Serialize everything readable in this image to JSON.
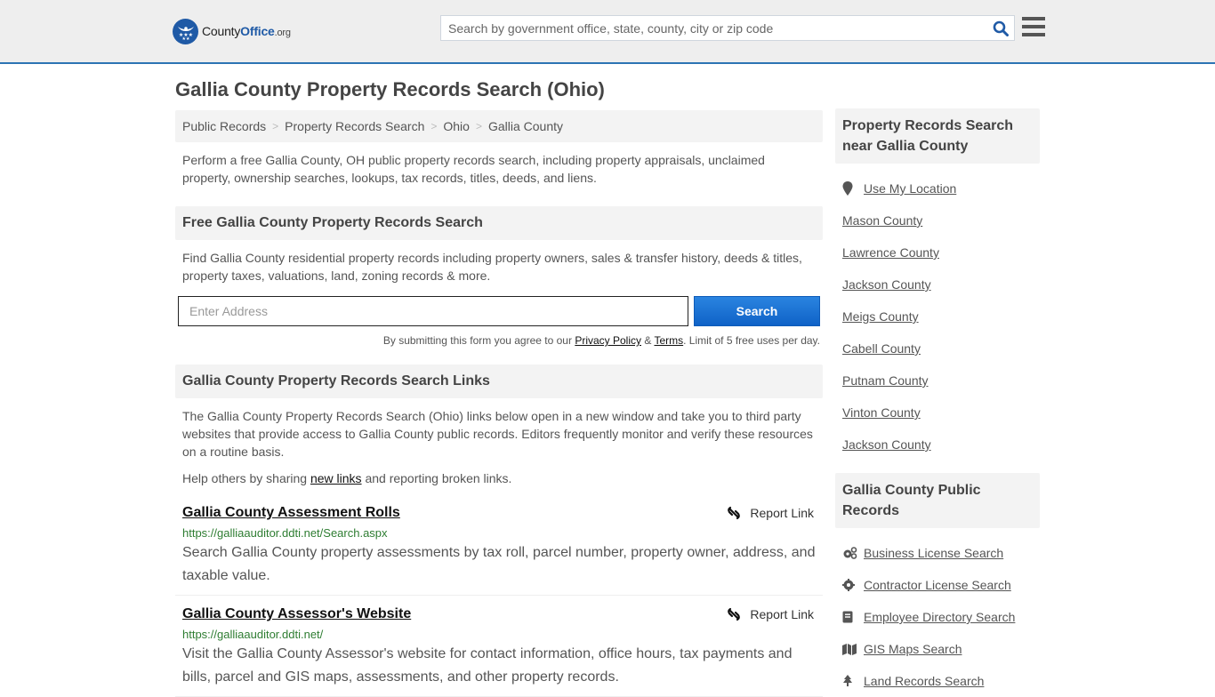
{
  "header": {
    "logo": {
      "brand_a": "County",
      "brand_b": "Office",
      "brand_c": ".org"
    },
    "search": {
      "placeholder": "Search by government office, state, county, city or zip code",
      "value": ""
    },
    "accent": "#2c74b3"
  },
  "page": {
    "title": "Gallia County Property Records Search (Ohio)"
  },
  "breadcrumb": [
    {
      "label": "Public Records"
    },
    {
      "label": "Property Records Search"
    },
    {
      "label": "Ohio"
    },
    {
      "label": "Gallia County"
    }
  ],
  "intro": "Perform a free Gallia County, OH public property records search, including property appraisals, unclaimed property, ownership searches, lookups, tax records, titles, deeds, and liens.",
  "free_search": {
    "heading": "Free Gallia County Property Records Search",
    "description": "Find Gallia County residential property records including property owners, sales & transfer history, deeds & titles, property taxes, valuations, land, zoning records & more.",
    "address_placeholder": "Enter Address",
    "address_value": "",
    "button_label": "Search",
    "terms_prefix": "By submitting this form you agree to our ",
    "privacy_label": "Privacy Policy",
    "terms_amp": " & ",
    "terms_label": "Terms",
    "terms_suffix": ". Limit of 5 free uses per day."
  },
  "links_section": {
    "heading": "Gallia County Property Records Search Links",
    "description": "The Gallia County Property Records Search (Ohio) links below open in a new window and take you to third party websites that provide access to Gallia County public records. Editors frequently monitor and verify these resources on a routine basis.",
    "help_prefix": "Help others by sharing ",
    "help_link": "new links",
    "help_suffix": " and reporting broken links.",
    "report_label": "Report Link",
    "items": [
      {
        "title": "Gallia County Assessment Rolls",
        "url": "https://galliaauditor.ddti.net/Search.aspx",
        "description": "Search Gallia County property assessments by tax roll, parcel number, property owner, address, and taxable value."
      },
      {
        "title": "Gallia County Assessor's Website",
        "url": "https://galliaauditor.ddti.net/",
        "description": "Visit the Gallia County Assessor's website for contact information, office hours, tax payments and bills, parcel and GIS maps, assessments, and other property records."
      }
    ]
  },
  "sidebar": {
    "nearby": {
      "heading": "Property Records Search near Gallia County",
      "use_location": "Use My Location",
      "counties": [
        "Mason County",
        "Lawrence County",
        "Jackson County",
        "Meigs County",
        "Cabell County",
        "Putnam County",
        "Vinton County",
        "Jackson County"
      ]
    },
    "public_records": {
      "heading": "Gallia County Public Records",
      "items": [
        {
          "label": "Business License Search",
          "icon": "gears-icon"
        },
        {
          "label": "Contractor License Search",
          "icon": "gear-icon"
        },
        {
          "label": "Employee Directory Search",
          "icon": "book-icon"
        },
        {
          "label": "GIS Maps Search",
          "icon": "map-icon"
        },
        {
          "label": "Land Records Search",
          "icon": "tree-icon"
        }
      ]
    }
  }
}
